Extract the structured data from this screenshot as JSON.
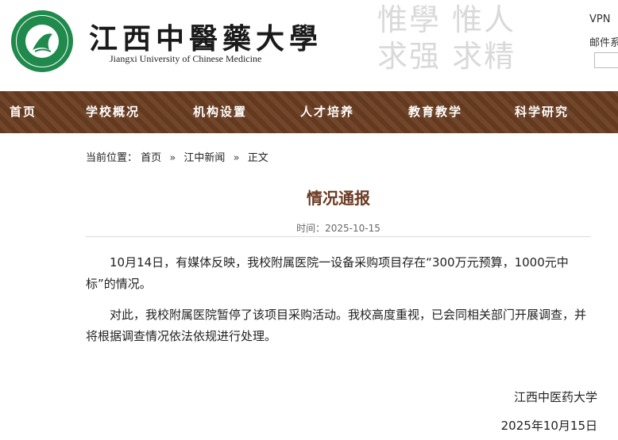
{
  "header": {
    "name_cn": "江西中醫藥大學",
    "name_en": "Jiangxi University of Chinese Medicine",
    "motto_line1": "惟學  惟人",
    "motto_line2": "求强  求精",
    "top_links": [
      "VPN",
      "邮件系"
    ]
  },
  "nav": {
    "items": [
      "首页",
      "学校概况",
      "机构设置",
      "人才培养",
      "教育教学",
      "科学研究"
    ]
  },
  "breadcrumb": {
    "label": "当前位置：",
    "items": [
      "首页",
      "江中新闻",
      "正文"
    ],
    "separator": "»"
  },
  "article": {
    "title": "情况通报",
    "meta": "时间：2025-10-15",
    "paragraphs": [
      "10月14日，有媒体反映，我校附属医院一设备采购项目存在“300万元预算，1000元中标”的情况。",
      "对此，我校附属医院暂停了该项目采购活动。我校高度重视，已会同相关部门开展调查，并将根据调查情况依法依规进行处理。"
    ],
    "signature": "江西中医药大学",
    "date": "2025年10月15日"
  },
  "colors": {
    "nav_bg": "#6b3e22",
    "title_color": "#6b3a22",
    "logo_green": "#1f8a4c"
  }
}
